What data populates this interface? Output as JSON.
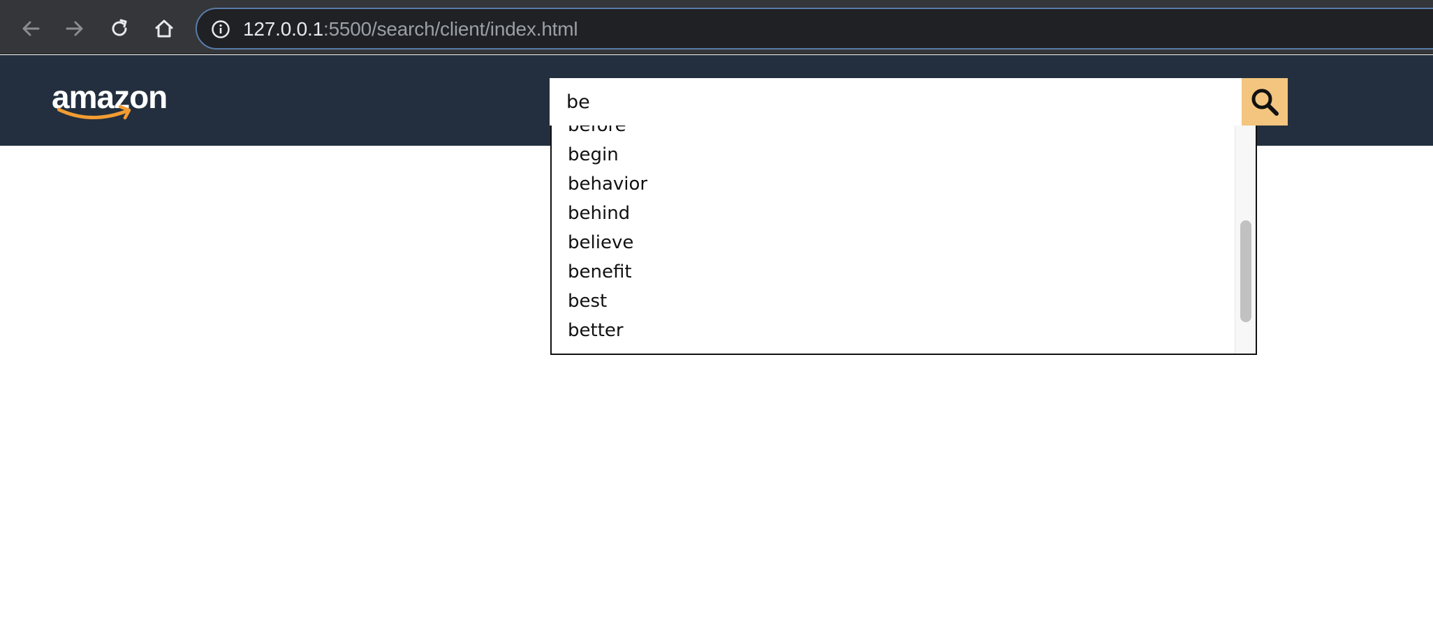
{
  "browser": {
    "url_host": "127.0.0.1",
    "url_rest": ":5500/search/client/index.html",
    "icons": [
      "back-arrow-icon",
      "forward-arrow-icon",
      "reload-icon",
      "home-icon",
      "info-icon"
    ]
  },
  "header": {
    "logo_text": "amazon",
    "background_color": "#232f3e",
    "logo_accent_color": "#f39c33"
  },
  "search": {
    "value": "be",
    "button_icon": "search-icon",
    "button_color": "#f3c57f"
  },
  "suggestions": {
    "items": [
      "before",
      "begin",
      "behavior",
      "behind",
      "believe",
      "benefit",
      "best",
      "better"
    ]
  }
}
